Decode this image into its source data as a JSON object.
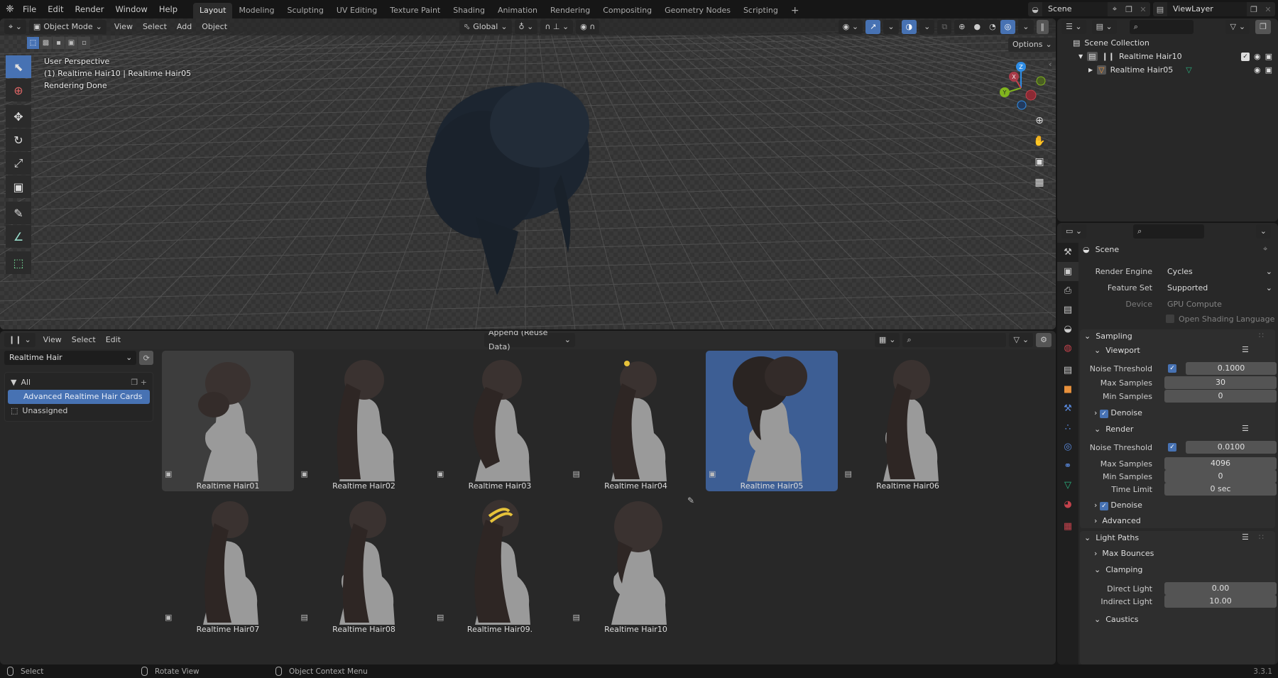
{
  "topbar": {
    "menus": [
      "File",
      "Edit",
      "Render",
      "Window",
      "Help"
    ],
    "workspaces": [
      "Layout",
      "Modeling",
      "Sculpting",
      "UV Editing",
      "Texture Paint",
      "Shading",
      "Animation",
      "Rendering",
      "Compositing",
      "Geometry Nodes",
      "Scripting"
    ],
    "active_workspace": "Layout",
    "add_workspace": "+",
    "scene_name": "Scene",
    "view_layer": "ViewLayer"
  },
  "viewport": {
    "header": {
      "mode": "Object Mode",
      "menus": [
        "View",
        "Select",
        "Add",
        "Object"
      ],
      "orientation": "Global",
      "options_label": "Options"
    },
    "info": {
      "perspective": "User Perspective",
      "object": "(1) Realtime Hair10 | Realtime Hair05",
      "status": "Rendering Done"
    },
    "gizmo_axes": {
      "x": "X",
      "y": "Y",
      "z": "Z"
    },
    "colors": {
      "x": "#c4424c",
      "y": "#80b41e",
      "z": "#2f8de5"
    }
  },
  "outliner": {
    "root": "Scene Collection",
    "items": [
      {
        "name": "Realtime Hair10",
        "type": "collection",
        "expanded": true
      },
      {
        "name": "Realtime Hair05",
        "type": "object",
        "expanded": false
      }
    ]
  },
  "asset_browser": {
    "header_menus": [
      "View",
      "Select",
      "Edit"
    ],
    "import_mode": "Append (Reuse Data)",
    "search_placeholder": "",
    "library": "Realtime Hair",
    "categories": {
      "root": "All",
      "items": [
        "Advanced Realtime Hair Cards"
      ],
      "selected": "Advanced Realtime Hair Cards",
      "unassigned": "Unassigned"
    },
    "assets": [
      {
        "name": "Realtime Hair01",
        "type": "object",
        "state": "hover"
      },
      {
        "name": "Realtime Hair02",
        "type": "object",
        "state": ""
      },
      {
        "name": "Realtime Hair03",
        "type": "object",
        "state": ""
      },
      {
        "name": "Realtime Hair04",
        "type": "collection",
        "state": ""
      },
      {
        "name": "Realtime Hair05",
        "type": "object",
        "state": "selected"
      },
      {
        "name": "Realtime Hair06",
        "type": "collection",
        "state": ""
      },
      {
        "name": "Realtime Hair07",
        "type": "object",
        "state": ""
      },
      {
        "name": "Realtime Hair08",
        "type": "collection",
        "state": ""
      },
      {
        "name": "Realtime Hair09.",
        "type": "collection",
        "state": ""
      },
      {
        "name": "Realtime Hair10",
        "type": "collection",
        "state": ""
      }
    ]
  },
  "properties": {
    "context": "Scene",
    "render_engine": {
      "label": "Render Engine",
      "value": "Cycles"
    },
    "feature_set": {
      "label": "Feature Set",
      "value": "Supported"
    },
    "device": {
      "label": "Device",
      "value": "GPU Compute"
    },
    "osl": {
      "label": "Open Shading Language",
      "checked": false
    },
    "sampling": {
      "title": "Sampling",
      "viewport": {
        "title": "Viewport",
        "noise_threshold": {
          "label": "Noise Threshold",
          "enabled": true,
          "value": "0.1000"
        },
        "max_samples": {
          "label": "Max Samples",
          "value": "30"
        },
        "min_samples": {
          "label": "Min Samples",
          "value": "0"
        },
        "denoise": {
          "label": "Denoise",
          "checked": true
        }
      },
      "render": {
        "title": "Render",
        "noise_threshold": {
          "label": "Noise Threshold",
          "enabled": true,
          "value": "0.0100"
        },
        "max_samples": {
          "label": "Max Samples",
          "value": "4096"
        },
        "min_samples": {
          "label": "Min Samples",
          "value": "0"
        },
        "time_limit": {
          "label": "Time Limit",
          "value": "0 sec"
        },
        "denoise": {
          "label": "Denoise",
          "checked": true
        }
      },
      "advanced": "Advanced"
    },
    "light_paths": {
      "title": "Light Paths",
      "max_bounces": "Max Bounces",
      "clamping": {
        "title": "Clamping",
        "direct": {
          "label": "Direct Light",
          "value": "0.00"
        },
        "indirect": {
          "label": "Indirect Light",
          "value": "10.00"
        }
      },
      "caustics": "Caustics"
    }
  },
  "statusbar": {
    "left": "Select",
    "middle": "Rotate View",
    "right": "Object Context Menu",
    "version": "3.3.1"
  },
  "accent_color": "#4772b3"
}
